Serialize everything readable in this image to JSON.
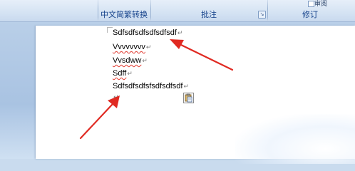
{
  "ribbon": {
    "groups": [
      {
        "label": "中文简繁转换"
      },
      {
        "label": "批注"
      },
      {
        "label": "修订"
      }
    ],
    "corner_text": "审阅"
  },
  "document": {
    "lines": [
      {
        "text": "Sdfsdfsdfsdfsdfsdf",
        "mark": "↵",
        "squiggle": false
      },
      {
        "text": "Vvvvvvvv",
        "mark": "↵",
        "squiggle": true
      },
      {
        "text": "Vvsdww",
        "mark": "↵",
        "squiggle": true
      },
      {
        "text": "Sdff",
        "mark": "↵",
        "squiggle": true
      },
      {
        "text": "Sdfsdfsdfsfsdfsdfsdf",
        "mark": "↵",
        "squiggle": false
      },
      {
        "text": "",
        "mark": "↵",
        "squiggle": false
      }
    ]
  },
  "annotation": {
    "arrow_color": "#e02a22"
  },
  "icons": {
    "paste_options": "paste-options-icon"
  }
}
